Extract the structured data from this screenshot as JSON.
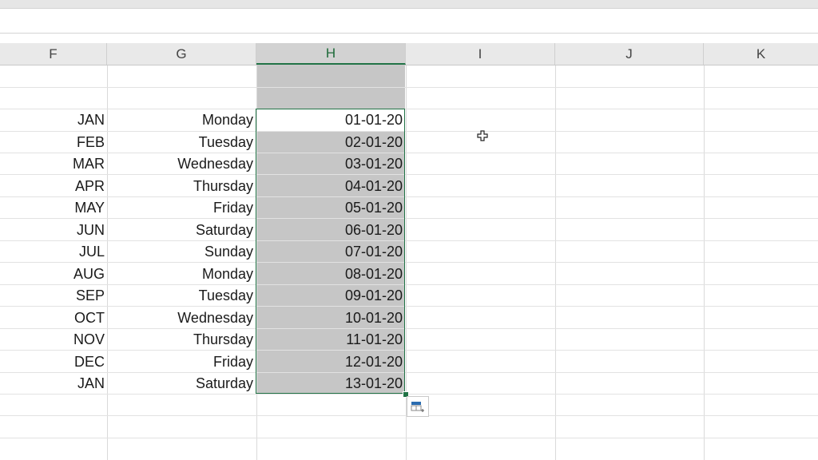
{
  "columns": [
    {
      "label": "F"
    },
    {
      "label": "G"
    },
    {
      "label": "H"
    },
    {
      "label": "I"
    },
    {
      "label": "J"
    },
    {
      "label": "K"
    }
  ],
  "selected_column": "H",
  "rows": [
    {
      "month": "JAN",
      "day": "Monday",
      "date": "01-01-20"
    },
    {
      "month": "FEB",
      "day": "Tuesday",
      "date": "02-01-20"
    },
    {
      "month": "MAR",
      "day": "Wednesday",
      "date": "03-01-20"
    },
    {
      "month": "APR",
      "day": "Thursday",
      "date": "04-01-20"
    },
    {
      "month": "MAY",
      "day": "Friday",
      "date": "05-01-20"
    },
    {
      "month": "JUN",
      "day": "Saturday",
      "date": "06-01-20"
    },
    {
      "month": "JUL",
      "day": "Sunday",
      "date": "07-01-20"
    },
    {
      "month": "AUG",
      "day": "Monday",
      "date": "08-01-20"
    },
    {
      "month": "SEP",
      "day": "Tuesday",
      "date": "09-01-20"
    },
    {
      "month": "OCT",
      "day": "Wednesday",
      "date": "10-01-20"
    },
    {
      "month": "NOV",
      "day": "Thursday",
      "date": "11-01-20"
    },
    {
      "month": "DEC",
      "day": "Friday",
      "date": "12-01-20"
    },
    {
      "month": "JAN",
      "day": "Saturday",
      "date": "13-01-20"
    }
  ],
  "icons": {
    "cursor": "cell-select-cursor-icon",
    "quick_analysis": "quick-analysis-icon"
  },
  "colors": {
    "accent": "#217346",
    "selection": "#c6c6c6",
    "header_bg": "#e9e9e9"
  }
}
